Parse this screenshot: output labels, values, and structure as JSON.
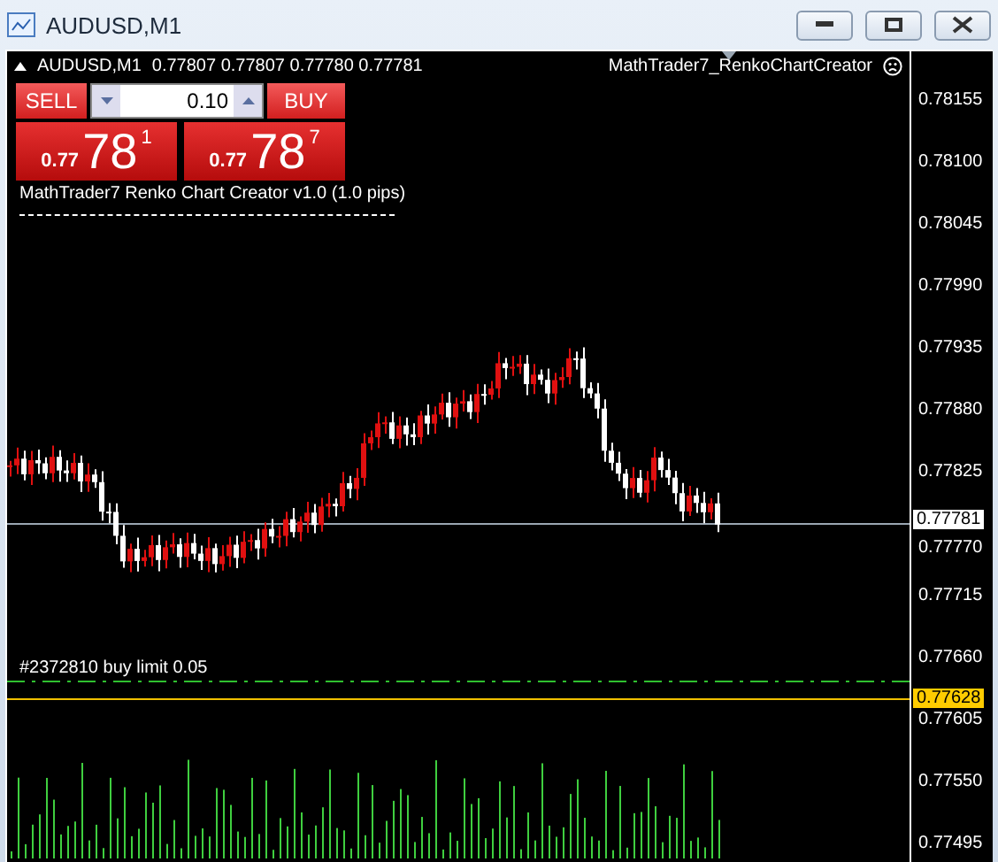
{
  "window": {
    "title": "AUDUSD,M1",
    "controls": [
      {
        "kind": "minimize"
      },
      {
        "kind": "restore"
      },
      {
        "kind": "close"
      }
    ]
  },
  "chart_header": {
    "symbol": "AUDUSD,M1",
    "ohlc": "0.77807 0.77807 0.77780 0.77781",
    "expert": "MathTrader7_RenkoChartCreator"
  },
  "trade_panel": {
    "sell": {
      "label": "SELL",
      "prefix": "0.77",
      "big": "78",
      "sup": "1"
    },
    "buy": {
      "label": "BUY",
      "prefix": "0.77",
      "big": "78",
      "sup": "7"
    },
    "lot": "0.10"
  },
  "indicator_label": "MathTrader7 Renko Chart Creator v1.0 (1.0 pips)",
  "order_label": "#2372810 buy limit 0.05",
  "price_scale": [
    "0.78155",
    "0.78100",
    "0.78045",
    "0.77990",
    "0.77935",
    "0.77880",
    "0.77825",
    "0.77770",
    "0.77715",
    "0.77660",
    "0.77605",
    "0.77550",
    "0.77495"
  ],
  "current_price": "0.77781",
  "order_price": "0.77628"
}
